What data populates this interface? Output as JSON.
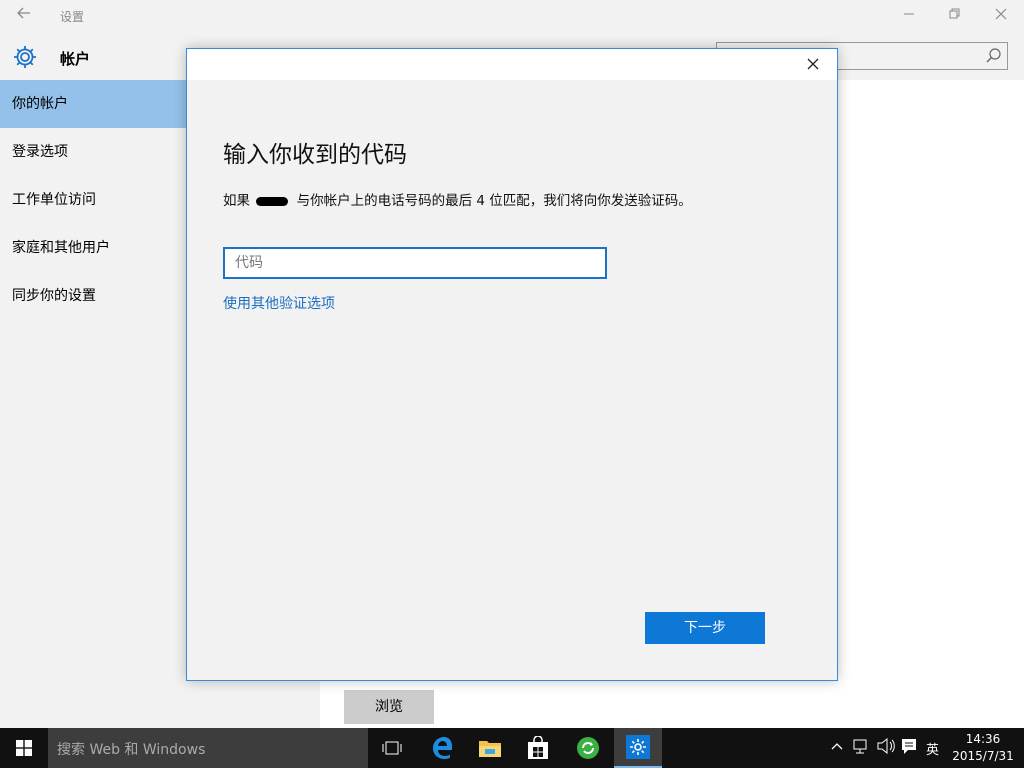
{
  "window": {
    "title": "设置",
    "controls": {
      "minimize": "—",
      "restore": "❐",
      "close": "✕"
    },
    "back_icon": "back-arrow-icon"
  },
  "sidebar": {
    "title": "帐户",
    "icon": "gear-icon",
    "items": [
      {
        "label": "你的帐户",
        "active": true
      },
      {
        "label": "登录选项"
      },
      {
        "label": "工作单位访问"
      },
      {
        "label": "家庭和其他用户"
      },
      {
        "label": "同步你的设置"
      }
    ]
  },
  "search": {
    "placeholder": ""
  },
  "content": {
    "browse_label": "浏览"
  },
  "dialog": {
    "heading": "输入你收到的代码",
    "desc_before": "如果",
    "desc_after": "与你帐户上的电话号码的最后 4 位匹配，我们将向你发送验证码。",
    "code_placeholder": "代码",
    "alt_link": "使用其他验证选项",
    "next_button": "下一步",
    "close": "✕"
  },
  "taskbar": {
    "search_placeholder": "搜索 Web 和 Windows",
    "time": "14:36",
    "date": "2015/7/31",
    "ime": "英",
    "accent": "#0e78d7"
  }
}
